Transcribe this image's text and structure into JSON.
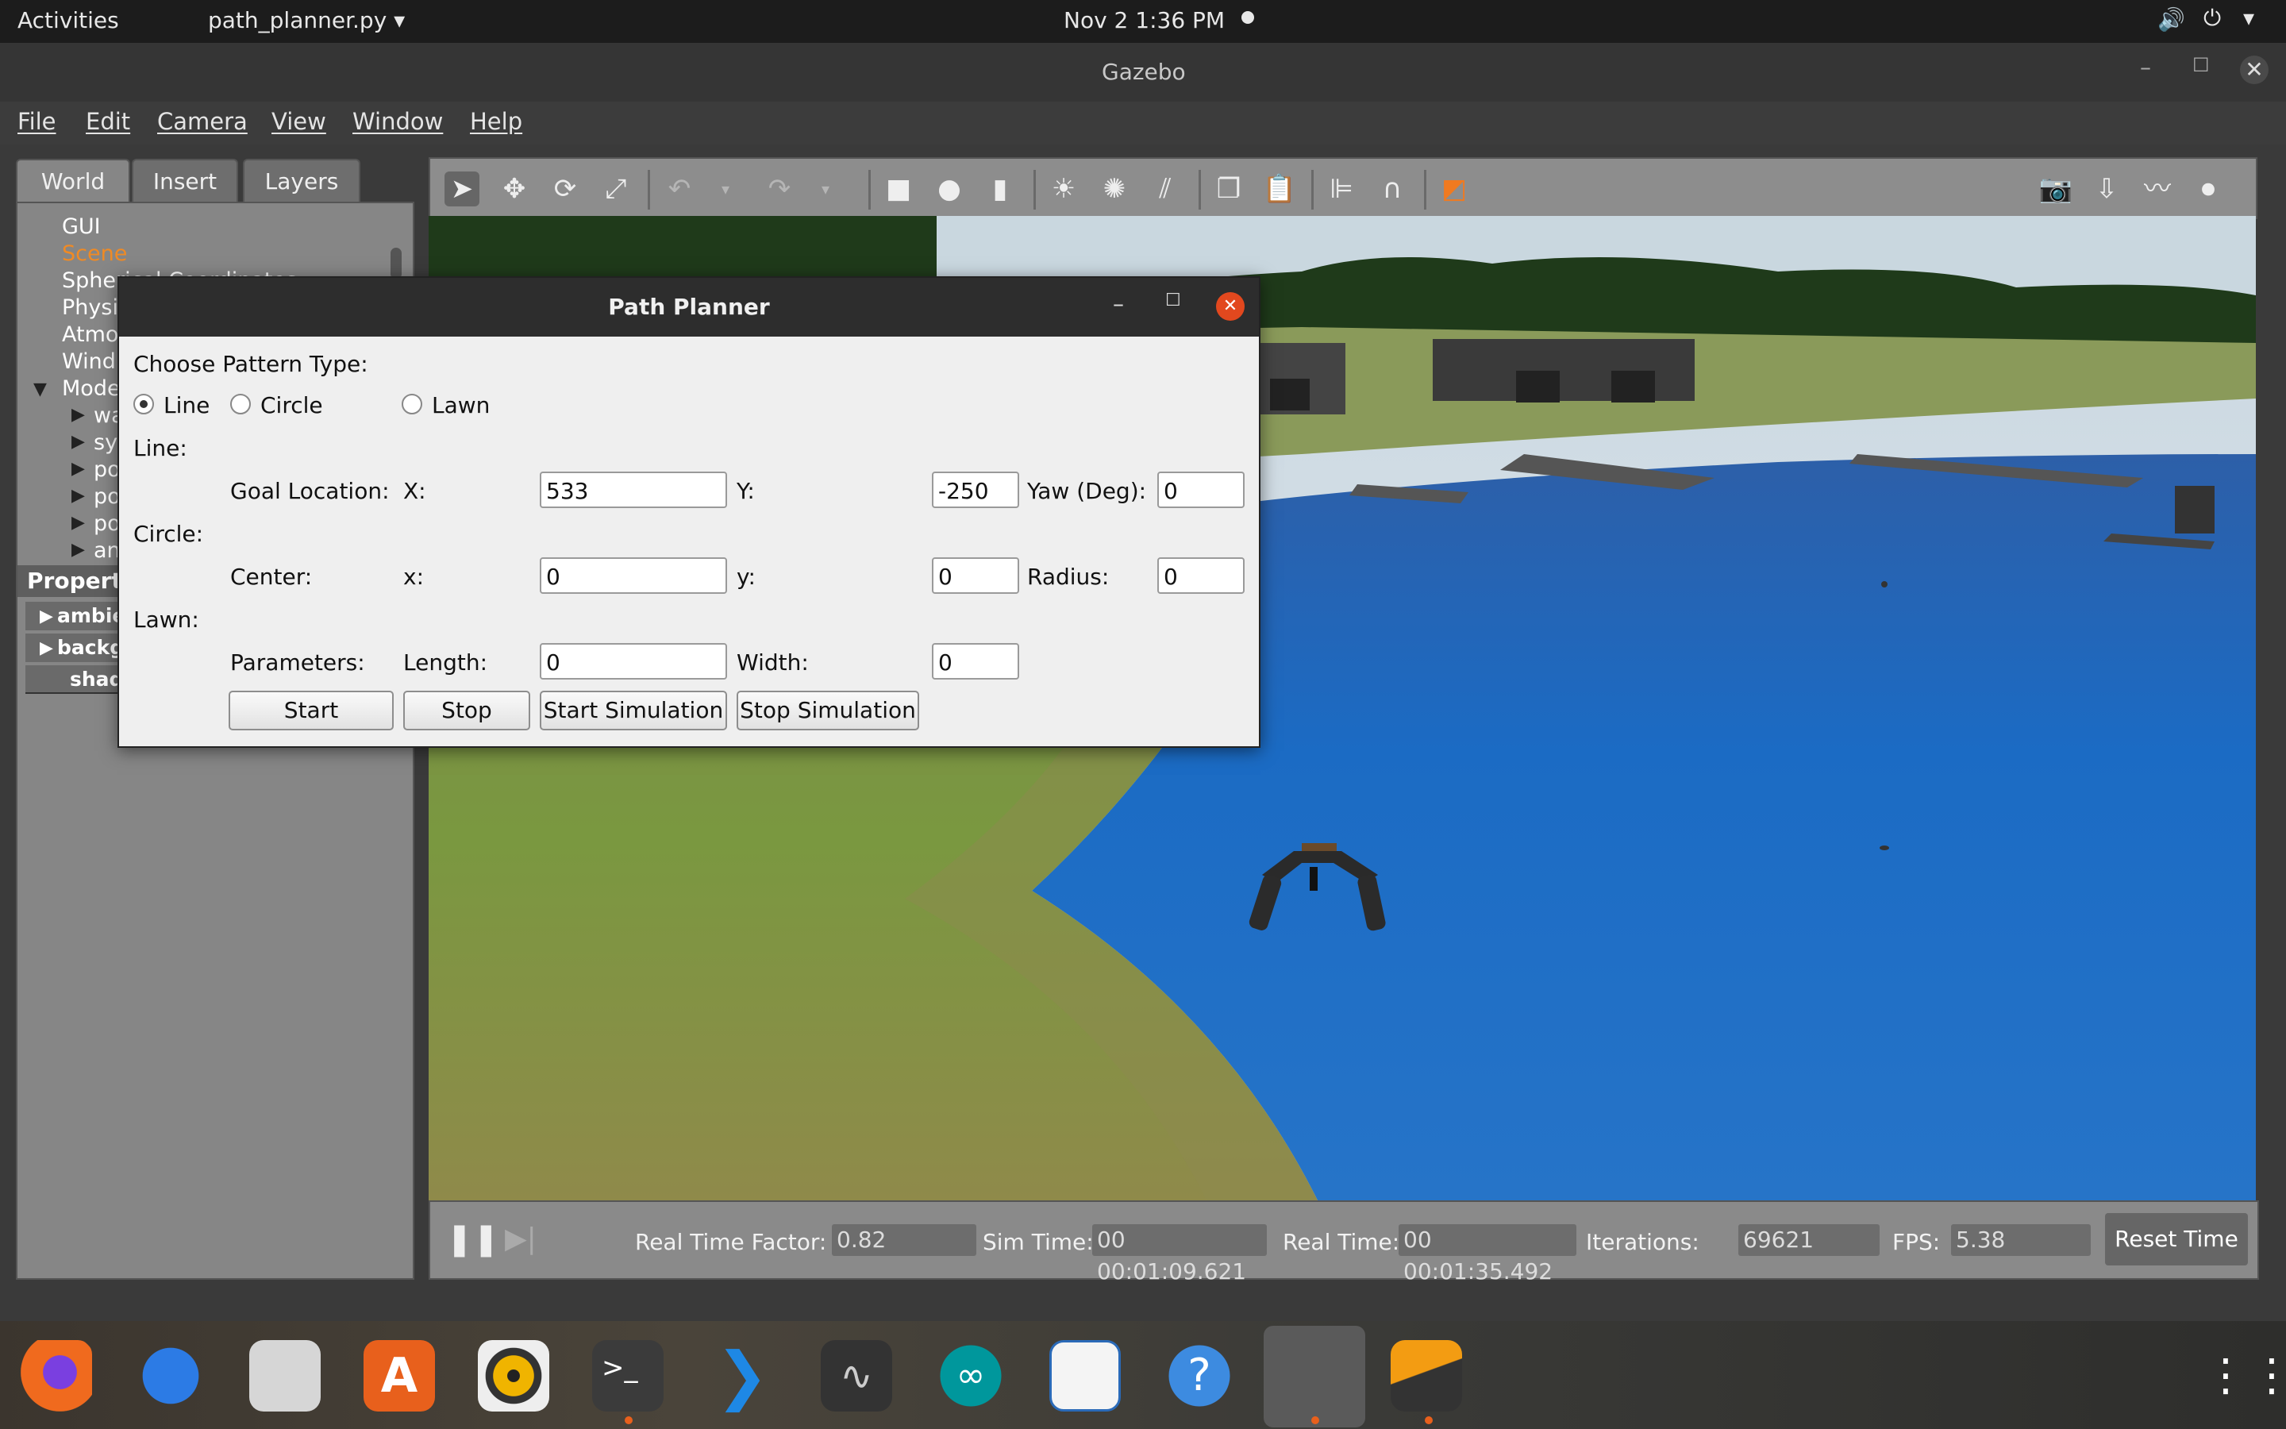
{
  "topbar": {
    "activities": "Activities",
    "app_menu": "path_planner.py ▾",
    "clock": "Nov 2  1:36 PM"
  },
  "gazebo": {
    "title": "Gazebo",
    "menu": [
      "File",
      "Edit",
      "Camera",
      "View",
      "Window",
      "Help"
    ],
    "tabs": [
      "World",
      "Insert",
      "Layers"
    ],
    "tree": [
      {
        "label": "GUI",
        "color": "#ffffff"
      },
      {
        "label": "Scene",
        "color": "#f08a24"
      },
      {
        "label": "Spherical Coordinates",
        "color": "#ffffff"
      },
      {
        "label": "Physi",
        "color": "#ffffff"
      },
      {
        "label": "Atmo",
        "color": "#ffffff"
      },
      {
        "label": "Wind",
        "color": "#ffffff"
      },
      {
        "label": "Mode",
        "color": "#ffffff"
      },
      {
        "label": "wa",
        "color": "#ffffff"
      },
      {
        "label": "sy",
        "color": "#ffffff"
      },
      {
        "label": "po",
        "color": "#ffffff"
      },
      {
        "label": "po",
        "color": "#ffffff"
      },
      {
        "label": "po",
        "color": "#ffffff"
      },
      {
        "label": "an",
        "color": "#ffffff"
      }
    ],
    "properties_label": "Property",
    "properties": [
      "ambie",
      "backg",
      "shado"
    ],
    "status": {
      "real_time_factor_label": "Real Time Factor:",
      "real_time_factor": "0.82",
      "sim_time_label": "Sim Time:",
      "sim_time": "00 00:01:09.621",
      "real_time_label": "Real Time:",
      "real_time": "00 00:01:35.492",
      "iterations_label": "Iterations:",
      "iterations": "69621",
      "fps_label": "FPS:",
      "fps": "5.38",
      "reset_label": "Reset Time"
    }
  },
  "dialog": {
    "title": "Path Planner",
    "choose_label": "Choose Pattern Type:",
    "radio_line": "Line",
    "radio_circle": "Circle",
    "radio_lawn": "Lawn",
    "line_header": "Line:",
    "goal_label": "Goal Location:",
    "x_label": "X:",
    "x_value": "533",
    "y_label": "Y:",
    "y_value": "-250",
    "yaw_label": "Yaw (Deg):",
    "yaw_value": "0",
    "circle_header": "Circle:",
    "center_label": "Center:",
    "cx_label": "x:",
    "cx_value": "0",
    "cy_label": "y:",
    "cy_value": "0",
    "radius_label": "Radius:",
    "radius_value": "0",
    "lawn_header": "Lawn:",
    "params_label": "Parameters:",
    "length_label": "Length:",
    "length_value": "0",
    "width_label": "Width:",
    "width_value": "0",
    "btn_start": "Start",
    "btn_stop": "Stop",
    "btn_start_sim": "Start Simulation",
    "btn_stop_sim": "Stop Simulation"
  },
  "dock": {
    "terminal_glyph": ">_",
    "help_glyph": "?",
    "apps": [
      "firefox-icon",
      "thunderbird-icon",
      "files-icon",
      "software-center-icon",
      "rhythmbox-icon",
      "terminal-icon",
      "vscode-icon",
      "system-monitor-icon",
      "arduino-icon",
      "writer-icon",
      "help-icon",
      "gazebo-app-icon",
      "sublime-icon",
      "app-grid-icon"
    ]
  }
}
